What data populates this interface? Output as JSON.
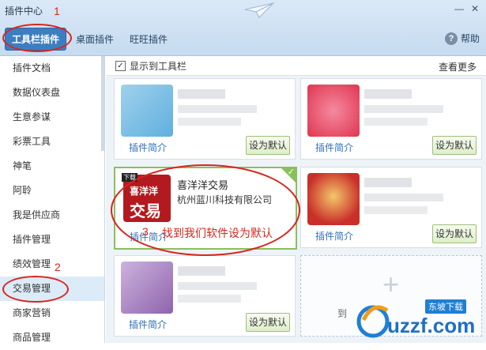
{
  "window": {
    "title": "插件中心"
  },
  "tabs": [
    {
      "label": "工具栏插件",
      "active": true
    },
    {
      "label": "桌面插件",
      "active": false
    },
    {
      "label": "旺旺插件",
      "active": false
    }
  ],
  "help": {
    "label": "帮助"
  },
  "sidebar": {
    "items": [
      {
        "label": "插件文档"
      },
      {
        "label": "数据仪表盘"
      },
      {
        "label": "生意参谋"
      },
      {
        "label": "彩票工具"
      },
      {
        "label": "神笔"
      },
      {
        "label": "阿聆"
      },
      {
        "label": "我是供应商"
      },
      {
        "label": "插件管理"
      },
      {
        "label": "绩效管理"
      },
      {
        "label": "交易管理",
        "active": true
      },
      {
        "label": "商家营销"
      },
      {
        "label": "商品管理"
      }
    ]
  },
  "toolbar": {
    "show_on_toolbar": "显示到工具栏",
    "see_more": "查看更多"
  },
  "cards": [
    {
      "intro": "插件简介",
      "button": "设为默认"
    },
    {
      "intro": "插件简介",
      "button": "设为默认"
    },
    {
      "intro": "插件简介",
      "name": "喜洋洋交易",
      "company": "杭州蓝川科技有限公司",
      "icon_text_top": "喜洋洋",
      "icon_text_bottom": "交易",
      "icon_badge": "下载"
    },
    {
      "intro": "插件简介",
      "button": "设为默认"
    },
    {
      "intro": "插件简介",
      "button": "设为默认"
    }
  ],
  "add_card": {
    "partial_label": "到"
  },
  "annotations": {
    "n1": "1",
    "n2": "2",
    "n3": "3",
    "instruction": "找到我们软件设为默认"
  },
  "watermark": {
    "text": "uzzf.com",
    "sub": "东坡下载"
  },
  "colors": {
    "accent": "#3d7ec0",
    "annotation": "#d7261d",
    "selected_border": "#8ac05a"
  }
}
